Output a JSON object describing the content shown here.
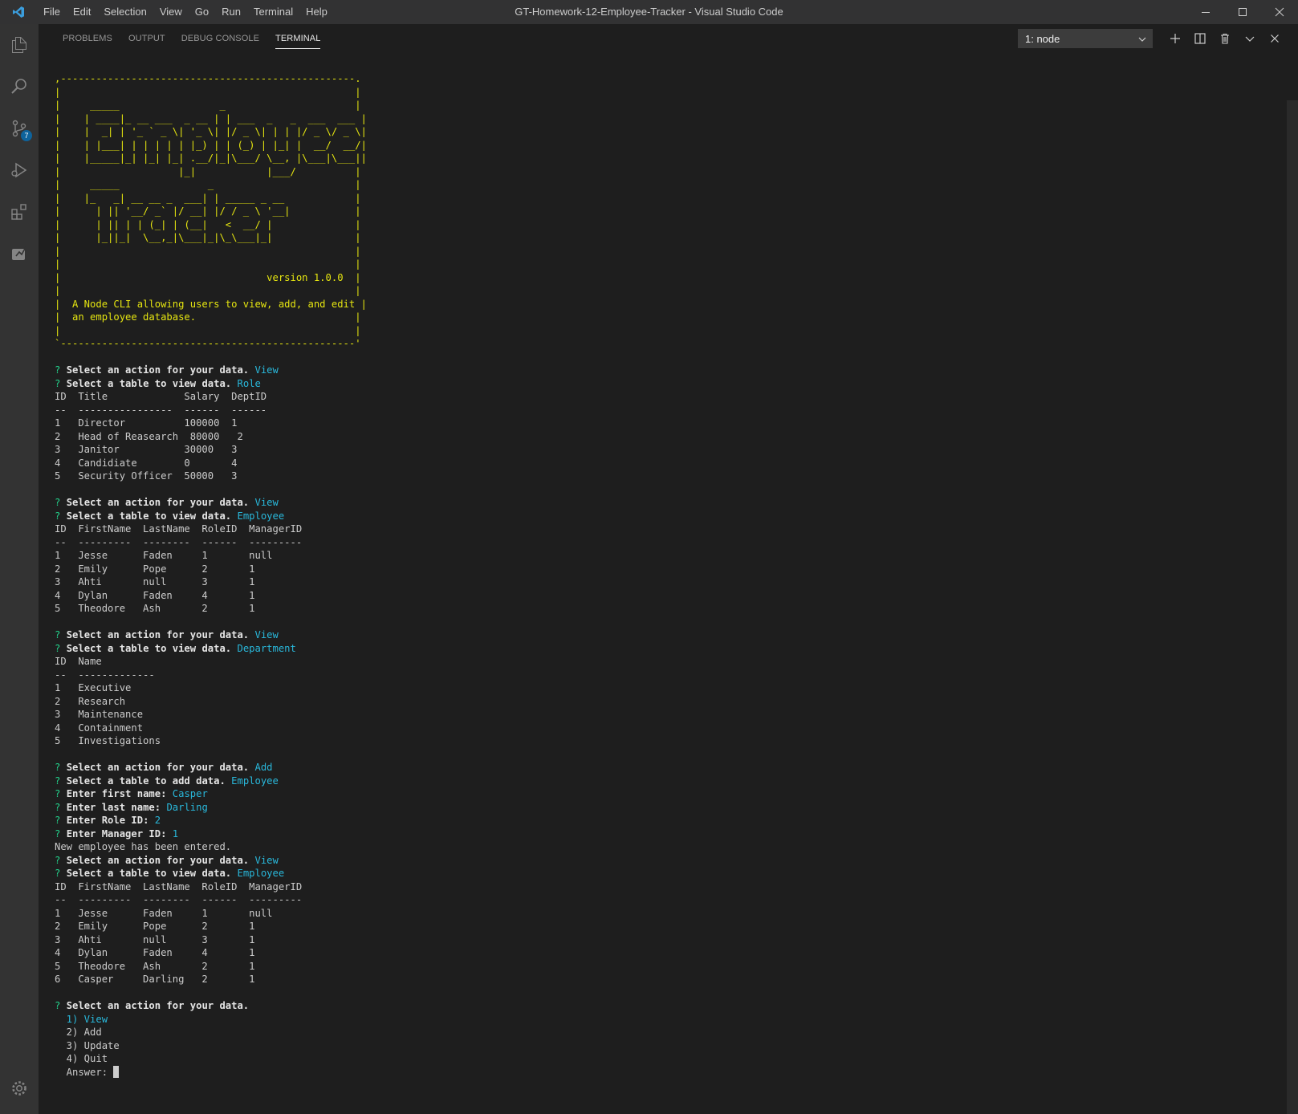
{
  "titlebar": {
    "menu": [
      "File",
      "Edit",
      "Selection",
      "View",
      "Go",
      "Run",
      "Terminal",
      "Help"
    ],
    "window_title": "GT-Homework-12-Employee-Tracker - Visual Studio Code"
  },
  "activitybar": {
    "items": [
      "explorer-icon",
      "search-icon",
      "source-control-icon",
      "run-debug-icon",
      "extensions-icon",
      "remote-explorer-icon"
    ],
    "scm_badge": "7"
  },
  "panel": {
    "tabs": [
      "PROBLEMS",
      "OUTPUT",
      "DEBUG CONSOLE",
      "TERMINAL"
    ],
    "active_tab": "TERMINAL",
    "terminal_select": "1: node"
  },
  "terminal": {
    "banner": [
      ",--------------------------------------------------.",
      "|                                                  |",
      "|     _____                 _                      |",
      "|    | ____|_ __ ___  _ __ | | ___  _   _  ___  ___ |",
      "|    |  _| | '_ ` _ \\| '_ \\| |/ _ \\| | | |/ _ \\/ _ \\|",
      "|    | |___| | | | | | |_) | | (_) | |_| |  __/  __/|",
      "|    |_____|_| |_| |_| .__/|_|\\___/ \\__, |\\___|\\___||",
      "|                    |_|            |___/          |",
      "|     _____               _                        |",
      "|    |_   _| __ __ _  ___| | _____ _ __            |",
      "|      | || '__/ _` |/ __| |/ / _ \\ '__|           |",
      "|      | || | | (_| | (__|   <  __/ |              |",
      "|      |_||_|  \\__,_|\\___|_|\\_\\___|_|              |",
      "|                                                  |",
      "|                                                  |",
      "|                                   version 1.0.0  |",
      "|                                                  |",
      "|  A Node CLI allowing users to view, add, and edit |",
      "|  an employee database.                           |",
      "|                                                  |",
      "`--------------------------------------------------'"
    ],
    "lines": [
      {
        "t": "blank"
      },
      {
        "t": "q",
        "text": "Select an action for your data.",
        "answer": "View"
      },
      {
        "t": "q",
        "text": "Select a table to view data.",
        "answer": "Role"
      },
      {
        "t": "plain",
        "text": "ID  Title             Salary  DeptID"
      },
      {
        "t": "plain",
        "text": "--  ----------------  ------  ------"
      },
      {
        "t": "plain",
        "text": "1   Director          100000  1"
      },
      {
        "t": "plain",
        "text": "2   Head of Reasearch  80000   2"
      },
      {
        "t": "plain",
        "text": "3   Janitor           30000   3"
      },
      {
        "t": "plain",
        "text": "4   Candidiate        0       4"
      },
      {
        "t": "plain",
        "text": "5   Security Officer  50000   3"
      },
      {
        "t": "blank"
      },
      {
        "t": "q",
        "text": "Select an action for your data.",
        "answer": "View"
      },
      {
        "t": "q",
        "text": "Select a table to view data.",
        "answer": "Employee"
      },
      {
        "t": "plain",
        "text": "ID  FirstName  LastName  RoleID  ManagerID"
      },
      {
        "t": "plain",
        "text": "--  ---------  --------  ------  ---------"
      },
      {
        "t": "plain",
        "text": "1   Jesse      Faden     1       null"
      },
      {
        "t": "plain",
        "text": "2   Emily      Pope      2       1"
      },
      {
        "t": "plain",
        "text": "3   Ahti       null      3       1"
      },
      {
        "t": "plain",
        "text": "4   Dylan      Faden     4       1"
      },
      {
        "t": "plain",
        "text": "5   Theodore   Ash       2       1"
      },
      {
        "t": "blank"
      },
      {
        "t": "q",
        "text": "Select an action for your data.",
        "answer": "View"
      },
      {
        "t": "q",
        "text": "Select a table to view data.",
        "answer": "Department"
      },
      {
        "t": "plain",
        "text": "ID  Name"
      },
      {
        "t": "plain",
        "text": "--  -------------"
      },
      {
        "t": "plain",
        "text": "1   Executive"
      },
      {
        "t": "plain",
        "text": "2   Research"
      },
      {
        "t": "plain",
        "text": "3   Maintenance"
      },
      {
        "t": "plain",
        "text": "4   Containment"
      },
      {
        "t": "plain",
        "text": "5   Investigations"
      },
      {
        "t": "blank"
      },
      {
        "t": "q",
        "text": "Select an action for your data.",
        "answer": "Add"
      },
      {
        "t": "q",
        "text": "Select a table to add data.",
        "answer": "Employee"
      },
      {
        "t": "q",
        "text": "Enter first name:",
        "answer": "Casper"
      },
      {
        "t": "q",
        "text": "Enter last name:",
        "answer": "Darling"
      },
      {
        "t": "q",
        "text": "Enter Role ID:",
        "answer": "2"
      },
      {
        "t": "q",
        "text": "Enter Manager ID:",
        "answer": "1"
      },
      {
        "t": "plain",
        "text": "New employee has been entered."
      },
      {
        "t": "q",
        "text": "Select an action for your data.",
        "answer": "View"
      },
      {
        "t": "q",
        "text": "Select a table to view data.",
        "answer": "Employee"
      },
      {
        "t": "plain",
        "text": "ID  FirstName  LastName  RoleID  ManagerID"
      },
      {
        "t": "plain",
        "text": "--  ---------  --------  ------  ---------"
      },
      {
        "t": "plain",
        "text": "1   Jesse      Faden     1       null"
      },
      {
        "t": "plain",
        "text": "2   Emily      Pope      2       1"
      },
      {
        "t": "plain",
        "text": "3   Ahti       null      3       1"
      },
      {
        "t": "plain",
        "text": "4   Dylan      Faden     4       1"
      },
      {
        "t": "plain",
        "text": "5   Theodore   Ash       2       1"
      },
      {
        "t": "plain",
        "text": "6   Casper     Darling   2       1"
      },
      {
        "t": "blank"
      },
      {
        "t": "q",
        "text": "Select an action for your data.",
        "answer": ""
      },
      {
        "t": "choice",
        "text": "  1) View",
        "selected": true
      },
      {
        "t": "choice",
        "text": "  2) Add",
        "selected": false
      },
      {
        "t": "choice",
        "text": "  3) Update",
        "selected": false
      },
      {
        "t": "choice",
        "text": "  4) Quit",
        "selected": false
      },
      {
        "t": "input",
        "text": "  Answer: "
      }
    ]
  },
  "colors": {
    "prompt_mark": "#23d18b",
    "answer": "#29b8db",
    "banner": "#e5e510",
    "background": "#1e1e1e"
  }
}
